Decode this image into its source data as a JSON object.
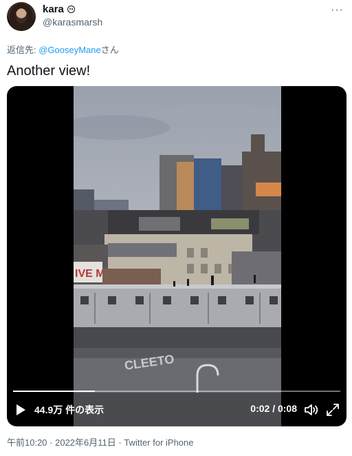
{
  "author": {
    "display_name": "kara",
    "handle": "@karasmarsh",
    "badge_icon": "smile-icon"
  },
  "reply": {
    "prefix": "返信先: ",
    "mention": "@GooseyMane",
    "suffix": "さん"
  },
  "tweet": {
    "text": "Another view!"
  },
  "video": {
    "views": "44.9万 件の表示",
    "time": "0:02 / 0:08",
    "progress": 0.25,
    "play_icon": "play-icon",
    "volume_icon": "volume-icon",
    "fullscreen_icon": "fullscreen-icon",
    "scene_text_1": "IVE ME",
    "scene_text_2": "CLEETO"
  },
  "meta": {
    "time": "午前10:20",
    "separator": " · ",
    "date": "2022年6月11日",
    "app": "Twitter for iPhone"
  },
  "colors": {
    "link": "#1d9bf0",
    "secondary": "#536471"
  }
}
